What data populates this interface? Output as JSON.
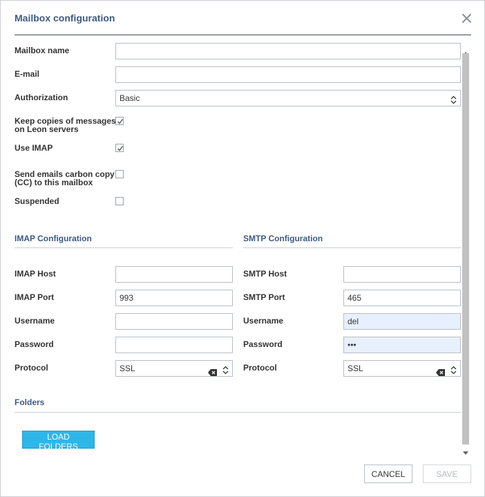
{
  "dialog": {
    "title": "Mailbox configuration",
    "close_icon": "close-icon"
  },
  "general": {
    "mailbox_name": {
      "label": "Mailbox name",
      "value": ""
    },
    "email": {
      "label": "E-mail",
      "value": ""
    },
    "authorization": {
      "label": "Authorization",
      "value": "Basic"
    },
    "keep_copies": {
      "label_line1": "Keep copies of messages",
      "label_line2": "on Leon servers",
      "checked": true
    },
    "use_imap": {
      "label": "Use IMAP",
      "checked": true
    },
    "send_cc": {
      "label_line1": "Send emails carbon copy",
      "label_line2": "(CC) to this mailbox",
      "checked": false
    },
    "suspended": {
      "label": "Suspended",
      "checked": false
    }
  },
  "imap": {
    "heading": "IMAP Configuration",
    "host": {
      "label": "IMAP Host",
      "value": ""
    },
    "port": {
      "label": "IMAP Port",
      "value": "993"
    },
    "username": {
      "label": "Username",
      "value": ""
    },
    "password": {
      "label": "Password",
      "value": ""
    },
    "protocol": {
      "label": "Protocol",
      "value": "SSL"
    }
  },
  "smtp": {
    "heading": "SMTP Configuration",
    "host": {
      "label": "SMTP Host",
      "value": ""
    },
    "port": {
      "label": "SMTP Port",
      "value": "465"
    },
    "username": {
      "label": "Username",
      "value": "del"
    },
    "password": {
      "label": "Password",
      "value": "•••"
    },
    "protocol": {
      "label": "Protocol",
      "value": "SSL"
    }
  },
  "folders": {
    "heading": "Folders",
    "load_button": "LOAD FOLDERS"
  },
  "footer": {
    "cancel_label": "CANCEL",
    "save_label": "SAVE"
  },
  "colors": {
    "heading": "#3d5a80",
    "primary_button": "#2eb6e8",
    "autofill": "#e8f0fe"
  }
}
